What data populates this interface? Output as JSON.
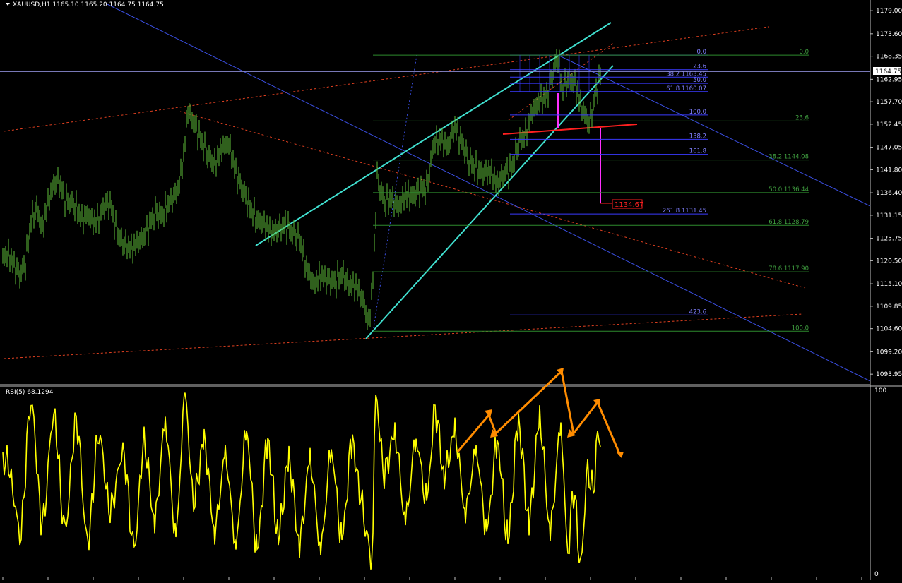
{
  "window": {
    "symbol_header": "XAUUSD,H1  1165.10 1165.20 1164.75 1164.75",
    "menu_arrow_icon": "triangle-down-icon"
  },
  "price_axis": {
    "ticks": [
      "1179.00",
      "1173.60",
      "1168.35",
      "1162.95",
      "1157.70",
      "1152.45",
      "1147.05",
      "1141.80",
      "1136.40",
      "1131.15",
      "1125.75",
      "1120.50",
      "1115.10",
      "1109.85",
      "1104.60",
      "1099.20",
      "1093.95"
    ],
    "current_price": "1164.75",
    "current_price_value": 1164.75,
    "ylim": [
      1091.5,
      1181.5
    ]
  },
  "fib_left": {
    "labels": [
      "0.0",
      "23.6",
      "38.2 1163.45",
      "50.0",
      "61.8 1160.07",
      "100.0",
      "138.2",
      "161.8",
      "261.8 1131.45",
      "423.6"
    ],
    "values": [
      1168.6,
      1165.2,
      1163.45,
      1162.0,
      1160.07,
      1154.6,
      1148.9,
      1145.4,
      1131.45,
      1107.8
    ]
  },
  "fib_right": {
    "labels": [
      "0.0",
      "23.6",
      "38.2 1144.08",
      "50.0 1136.44",
      "61.8 1128.79",
      "78.6 1117.90",
      "100.0"
    ],
    "values": [
      1168.6,
      1153.2,
      1144.08,
      1136.44,
      1128.79,
      1117.9,
      1104.0
    ]
  },
  "target_label": "1134.67",
  "target_value": 1134.67,
  "rsi": {
    "label": "RSI(5) 68.1294",
    "level_top": "100",
    "level_bottom": "0"
  },
  "colors": {
    "background": "#000000",
    "candles": "#5fbf3a",
    "channel": "#40e0d0",
    "fib_blue": "#3a3aff",
    "fib_green": "#2e8b2e",
    "trend_blue": "#3a4ee0",
    "red_dashed": "#e04020",
    "neckline": "#ff2020",
    "magenta": "#ff30ff",
    "rsi_line": "#ffff00",
    "arrows": "#ff8c00",
    "axis_text": "#ffffff",
    "fib_label_blue": "#8080ff",
    "fib_label_green": "#40a040"
  },
  "chart_data": {
    "type": "line",
    "title": "XAUUSD,H1",
    "series": [
      {
        "name": "XAUUSD,H1",
        "x": [
          0,
          8,
          16,
          24,
          32,
          40,
          48,
          56,
          64,
          72,
          80,
          88,
          96,
          104,
          112,
          120,
          128,
          136,
          144,
          152,
          160,
          168,
          176,
          184,
          192,
          200,
          208,
          216,
          224,
          232,
          240,
          248,
          256,
          262,
          270,
          280,
          290,
          300,
          310,
          320,
          330,
          340,
          350,
          360,
          370,
          380,
          390,
          400,
          410,
          420,
          430,
          440,
          450,
          460,
          470,
          480,
          490,
          500,
          510,
          518,
          524,
          530,
          540,
          550,
          560,
          570,
          580,
          590,
          600,
          610,
          620,
          630,
          640,
          650,
          660,
          670,
          680,
          690,
          700,
          710,
          720,
          730,
          740,
          750,
          760,
          770,
          780,
          786,
          792,
          800,
          810,
          820,
          830,
          840,
          848
        ],
        "y": [
          1121.5,
          1122.0,
          1119.5,
          1117.0,
          1120.0,
          1130.0,
          1133.0,
          1128.0,
          1134.0,
          1138.5,
          1139.0,
          1135.0,
          1134.0,
          1133.0,
          1130.0,
          1131.5,
          1129.5,
          1130.5,
          1133.5,
          1134.0,
          1128.0,
          1125.0,
          1124.0,
          1123.5,
          1125.0,
          1126.0,
          1129.0,
          1132.0,
          1131.0,
          1133.0,
          1135.0,
          1137.0,
          1145.0,
          1156.0,
          1153.0,
          1149.0,
          1145.0,
          1143.0,
          1147.0,
          1148.0,
          1141.0,
          1137.0,
          1133.0,
          1130.0,
          1129.0,
          1127.0,
          1128.0,
          1129.0,
          1127.0,
          1125.5,
          1119.0,
          1115.0,
          1117.0,
          1116.0,
          1115.5,
          1117.5,
          1115.0,
          1114.5,
          1111.0,
          1105.5,
          1116.0,
          1140.0,
          1134.0,
          1135.0,
          1133.0,
          1136.0,
          1135.5,
          1137.0,
          1137.5,
          1148.0,
          1149.0,
          1147.0,
          1152.0,
          1148.0,
          1144.0,
          1142.0,
          1141.0,
          1141.5,
          1138.5,
          1141.0,
          1142.0,
          1148.0,
          1150.0,
          1155.5,
          1158.0,
          1159.0,
          1165.0,
          1168.5,
          1160.0,
          1163.0,
          1162.0,
          1156.0,
          1152.5,
          1160.0,
          1165.0
        ]
      },
      {
        "name": "RSI(5)",
        "x": [
          0,
          8,
          16,
          24,
          40,
          56,
          72,
          88,
          104,
          120,
          136,
          152,
          170,
          186,
          200,
          215,
          230,
          245,
          258,
          270,
          285,
          300,
          315,
          330,
          345,
          360,
          375,
          390,
          405,
          420,
          435,
          450,
          465,
          480,
          495,
          505,
          515,
          522,
          528,
          540,
          555,
          570,
          585,
          600,
          612,
          625,
          640,
          655,
          670,
          685,
          700,
          715,
          730,
          745,
          760,
          775,
          790,
          800,
          808,
          818,
          828,
          836,
          842,
          848
        ],
        "y": [
          62,
          60,
          40,
          20,
          92,
          28,
          85,
          25,
          82,
          18,
          75,
          35,
          65,
          15,
          70,
          30,
          80,
          22,
          95,
          40,
          70,
          25,
          62,
          18,
          75,
          15,
          70,
          22,
          60,
          18,
          60,
          15,
          65,
          20,
          72,
          45,
          22,
          5,
          95,
          55,
          75,
          30,
          72,
          40,
          88,
          55,
          75,
          35,
          65,
          25,
          70,
          20,
          80,
          30,
          82,
          25,
          78,
          12,
          45,
          5,
          55,
          45,
          75,
          70
        ]
      }
    ],
    "xlabel": "",
    "ylabel": "",
    "ylim": [
      1091.5,
      1181.5
    ],
    "rsi_ylim": [
      0,
      100
    ]
  }
}
